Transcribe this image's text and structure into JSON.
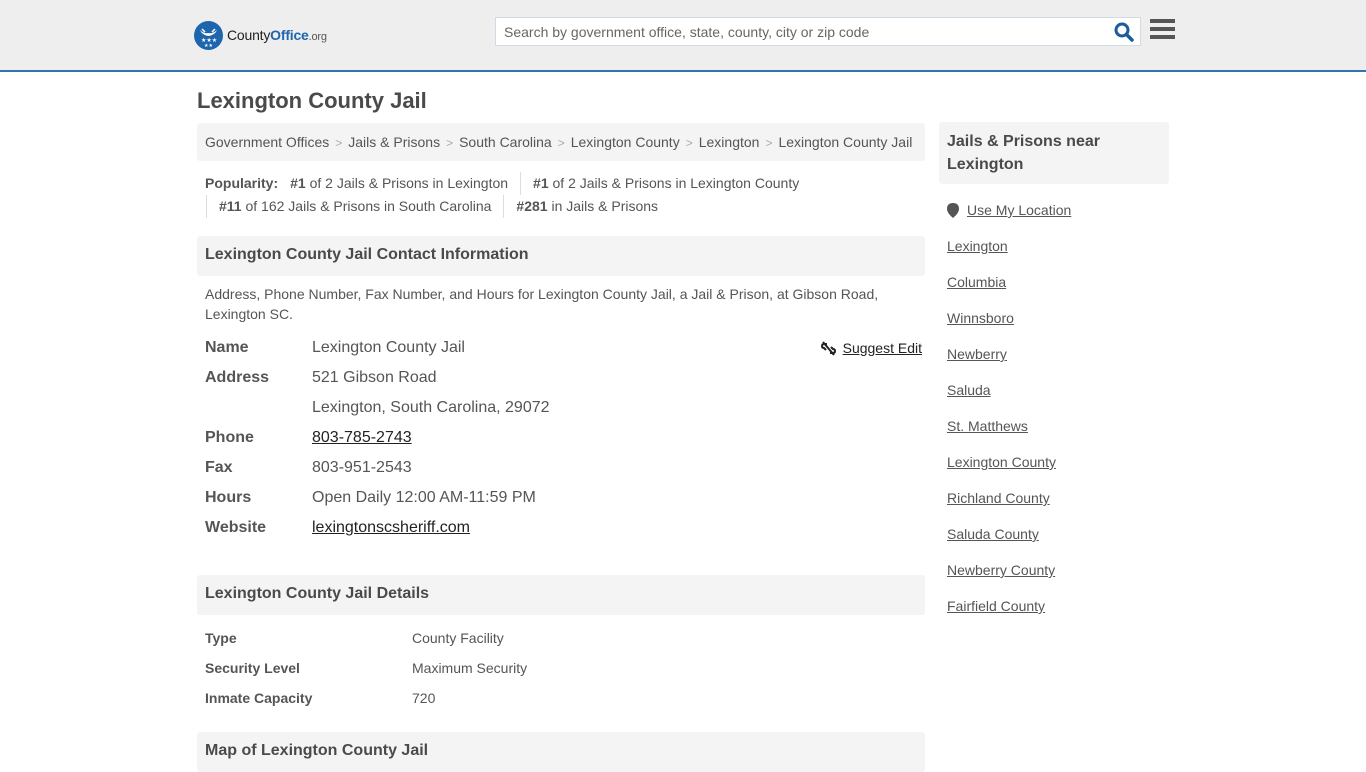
{
  "header": {
    "logo": {
      "part1": "County",
      "part2": "Office",
      "part3": ".org"
    },
    "search": {
      "placeholder": "Search by government office, state, county, city or zip code",
      "value": ""
    },
    "icons": {
      "search": "search-icon",
      "menu": "hamburger-menu-icon",
      "logo": "eagle-stars-badge-icon"
    },
    "accent_color": "#2e76b3"
  },
  "page": {
    "title": "Lexington County Jail"
  },
  "breadcrumb": [
    "Government Offices",
    "Jails & Prisons",
    "South Carolina",
    "Lexington County",
    "Lexington",
    "Lexington County Jail"
  ],
  "popularity": {
    "label": "Popularity:",
    "items": [
      {
        "rank": "#1",
        "text": " of 2 Jails & Prisons in Lexington"
      },
      {
        "rank": "#1",
        "text": " of 2 Jails & Prisons in Lexington County"
      },
      {
        "rank": "#11",
        "text": " of 162 Jails & Prisons in South Carolina"
      },
      {
        "rank": "#281",
        "text": " in Jails & Prisons"
      }
    ]
  },
  "contact": {
    "heading": "Lexington County Jail Contact Information",
    "description": "Address, Phone Number, Fax Number, and Hours for Lexington County Jail, a Jail & Prison, at Gibson Road, Lexington SC.",
    "suggest_edit": "Suggest Edit",
    "rows": {
      "name": {
        "label": "Name",
        "value": "Lexington County Jail"
      },
      "address": {
        "label": "Address",
        "line1": "521 Gibson Road",
        "line2": "Lexington, South Carolina, 29072"
      },
      "phone": {
        "label": "Phone",
        "value": "803-785-2743"
      },
      "fax": {
        "label": "Fax",
        "value": "803-951-2543"
      },
      "hours": {
        "label": "Hours",
        "value": "Open Daily 12:00 AM-11:59 PM"
      },
      "website": {
        "label": "Website",
        "value": "lexingtonscsheriff.com"
      }
    }
  },
  "details": {
    "heading": "Lexington County Jail Details",
    "rows": [
      {
        "label": "Type",
        "value": "County Facility"
      },
      {
        "label": "Security Level",
        "value": "Maximum Security"
      },
      {
        "label": "Inmate Capacity",
        "value": "720"
      }
    ]
  },
  "map": {
    "heading": "Map of Lexington County Jail"
  },
  "sidebar": {
    "heading": "Jails & Prisons near Lexington",
    "use_location": "Use My Location",
    "links": [
      "Lexington",
      "Columbia",
      "Winnsboro",
      "Newberry",
      "Saluda",
      "St. Matthews",
      "Lexington County",
      "Richland County",
      "Saluda County",
      "Newberry County",
      "Fairfield County"
    ]
  }
}
